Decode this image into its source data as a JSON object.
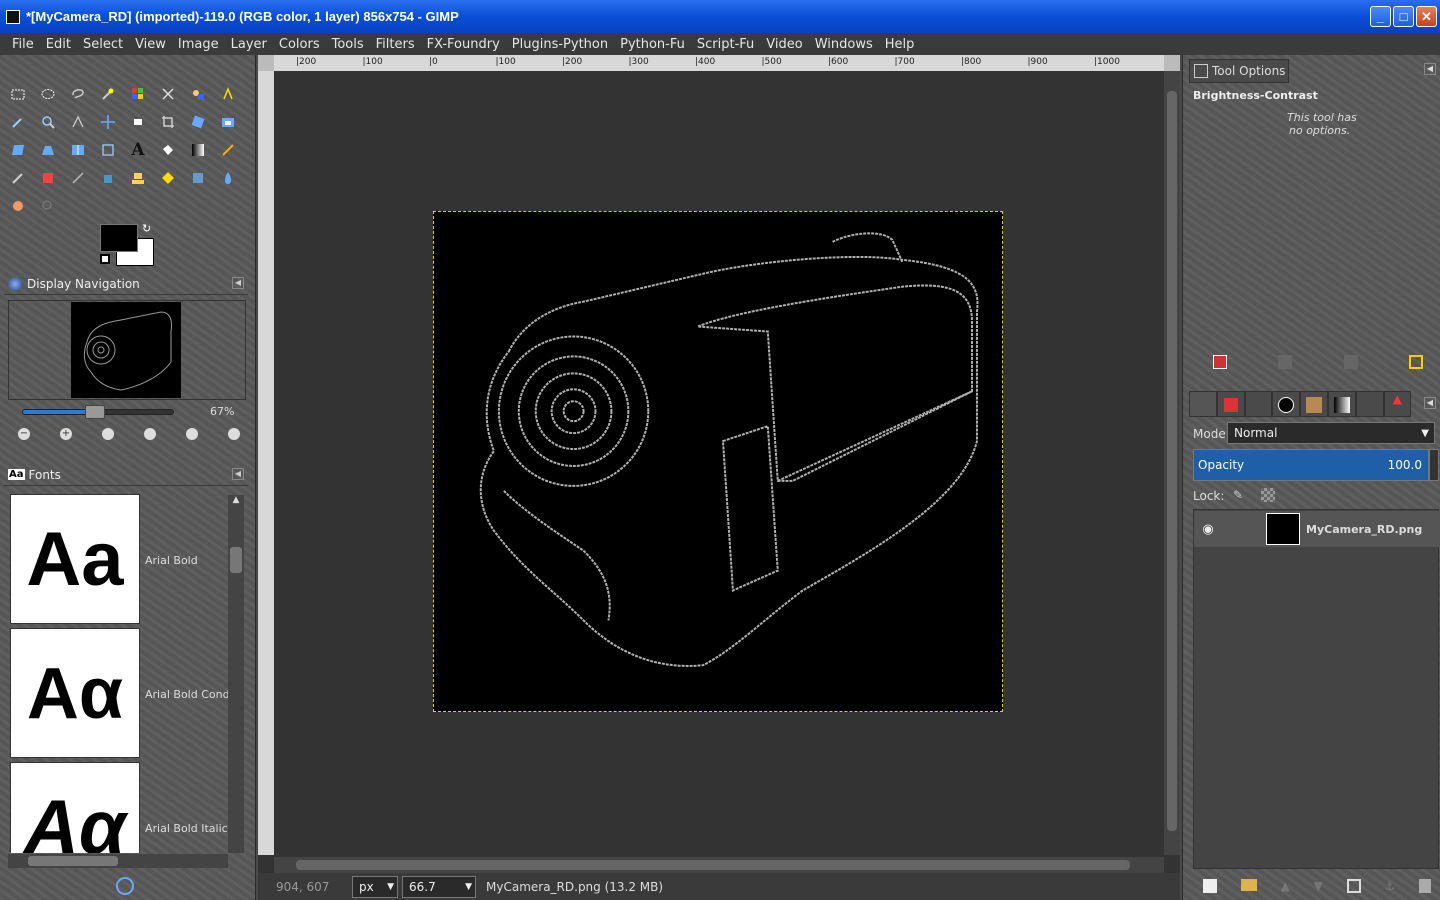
{
  "window": {
    "title": "*[MyCamera_RD] (imported)-119.0 (RGB color, 1 layer) 856x754 - GIMP",
    "buttons": {
      "minimize": "_",
      "maximize": "□",
      "close": "✕"
    }
  },
  "menu": [
    "File",
    "Edit",
    "Select",
    "View",
    "Image",
    "Layer",
    "Colors",
    "Tools",
    "Filters",
    "FX-Foundry",
    "Plugins-Python",
    "Python-Fu",
    "Script-Fu",
    "Video",
    "Windows",
    "Help"
  ],
  "navigation": {
    "title": "Display Navigation",
    "zoom": "67%",
    "zoom_fraction": 0.48
  },
  "fonts_dock": {
    "title": "Fonts",
    "icon_label": "Aa",
    "items": [
      {
        "sample": "Aa",
        "name": "Arial Bold"
      },
      {
        "sample": "Aα",
        "name": "Arial Bold Conde"
      },
      {
        "sample": "Aα",
        "name": "Arial Bold Italic"
      }
    ]
  },
  "ruler": {
    "labels": [
      "|200",
      "|100",
      "|0",
      "|100",
      "|200",
      "|300",
      "|400",
      "|500",
      "|600",
      "|700",
      "|800",
      "|900",
      "|1000"
    ]
  },
  "status": {
    "coords": "904, 607",
    "unit": "px",
    "zoom": "66.7",
    "file_info": "MyCamera_RD.png (13.2 MB)"
  },
  "tool_options": {
    "tab": "Tool Options",
    "tool_name": "Brightness-Contrast",
    "message_line1": "This tool has",
    "message_line2": "no options."
  },
  "layers": {
    "mode_label": "Mode:",
    "mode_value": "Normal",
    "opacity_label": "Opacity",
    "opacity_value": "100.0",
    "lock_label": "Lock:",
    "layer_name": "MyCamera_RD.png"
  },
  "colors": {
    "titlebar": "#0a4ed8",
    "selection": "#e6d600",
    "opacity_fill": "#1e5fa8"
  }
}
